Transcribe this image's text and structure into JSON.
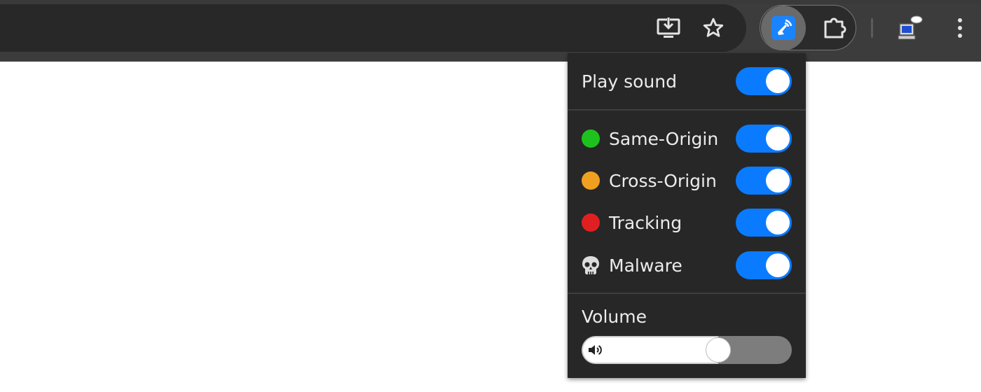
{
  "toolbar": {
    "install_icon": "install-app-icon",
    "bookmark_icon": "star-icon",
    "extension_icon": "sound-alert-extension-icon",
    "extensions_menu_icon": "puzzle-icon",
    "profile_icon": "computer-avatar-icon",
    "menu_icon": "kebab-menu-icon"
  },
  "popup": {
    "play_sound": {
      "label": "Play sound",
      "enabled": true
    },
    "categories": [
      {
        "label": "Same-Origin",
        "color": "#1ec21e",
        "icon": "green-dot-icon",
        "enabled": true
      },
      {
        "label": "Cross-Origin",
        "color": "#f0a020",
        "icon": "orange-dot-icon",
        "enabled": true
      },
      {
        "label": "Tracking",
        "color": "#e02020",
        "icon": "red-dot-icon",
        "enabled": true
      },
      {
        "label": "Malware",
        "color": "#dcdcdc",
        "icon": "skull-icon",
        "enabled": true
      }
    ],
    "volume": {
      "label": "Volume",
      "value": 0.75,
      "icon": "speaker-icon"
    }
  },
  "colors": {
    "toggle_on": "#0a7bff",
    "popup_bg": "#272727",
    "toolbar_bg": "#3c3c3c"
  }
}
